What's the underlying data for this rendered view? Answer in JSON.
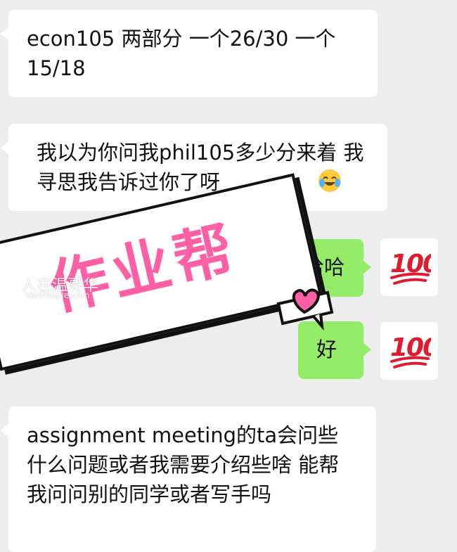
{
  "chat": {
    "messages": [
      {
        "text": "econ105 两部分 一个26/30 一个15/18"
      },
      {
        "text": "我以为你问我phil105多少分来着 我寻思我告诉过你了呀"
      },
      {
        "text": "哈哈"
      },
      {
        "text": "好"
      },
      {
        "text": "assignment meeting的ta会问些什么问题或者我需要介绍些啥 能帮我问问别的同学或者写手吗"
      }
    ],
    "emoji_1": "hundred-points-emoji",
    "emoji_2": "hundred-points-emoji",
    "laughing_emoji": "rolling-on-floor-laughing-emoji"
  },
  "sticker": {
    "text": "作业帮"
  },
  "watermark": {
    "cn": "人在温哥华",
    "en": "VanPeople.com"
  },
  "colors": {
    "background": "#ededed",
    "incoming_bubble": "#ffffff",
    "outgoing_bubble": "#95ec69",
    "sticker_text": "#ff5fa5",
    "hundred": "#e01b2f"
  }
}
